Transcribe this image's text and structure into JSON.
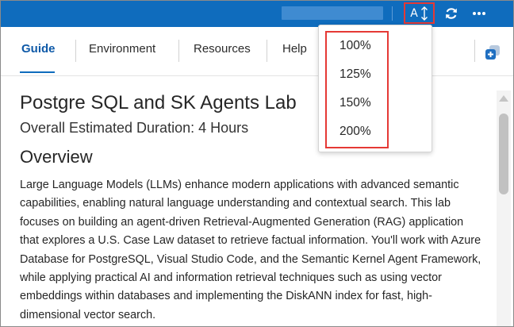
{
  "topbar": {
    "font_button_letter": "A",
    "icons": {
      "font_size": "text-size-icon",
      "refresh": "refresh-icon",
      "more": "more-horizontal-icon"
    },
    "colors": {
      "bar": "#0f6cbd",
      "highlight": "#e53935"
    }
  },
  "tabs": [
    {
      "label": "Guide",
      "active": true
    },
    {
      "label": "Environment",
      "active": false
    },
    {
      "label": "Resources",
      "active": false
    },
    {
      "label": "Help",
      "active": false
    }
  ],
  "tabs_right_icon": "copy-to-vm-icon",
  "zoom_menu": {
    "options": [
      "100%",
      "125%",
      "150%",
      "200%"
    ]
  },
  "content": {
    "title": "Postgre SQL and SK Agents Lab",
    "duration": "Overall Estimated Duration: 4 Hours",
    "section_heading": "Overview",
    "paragraph": "Large Language Models (LLMs) enhance modern applications with advanced semantic capabilities, enabling natural language understanding and contextual search. This lab focuses on building an agent-driven Retrieval-Augmented Generation (RAG) application that explores a U.S. Case Law dataset to retrieve factual information. You'll work with Azure Database for PostgreSQL, Visual Studio Code, and the Semantic Kernel Agent Framework, while applying practical AI and information retrieval techniques such as using vector embeddings within databases and implementing the DiskANN index for fast, high-dimensional vector search."
  }
}
